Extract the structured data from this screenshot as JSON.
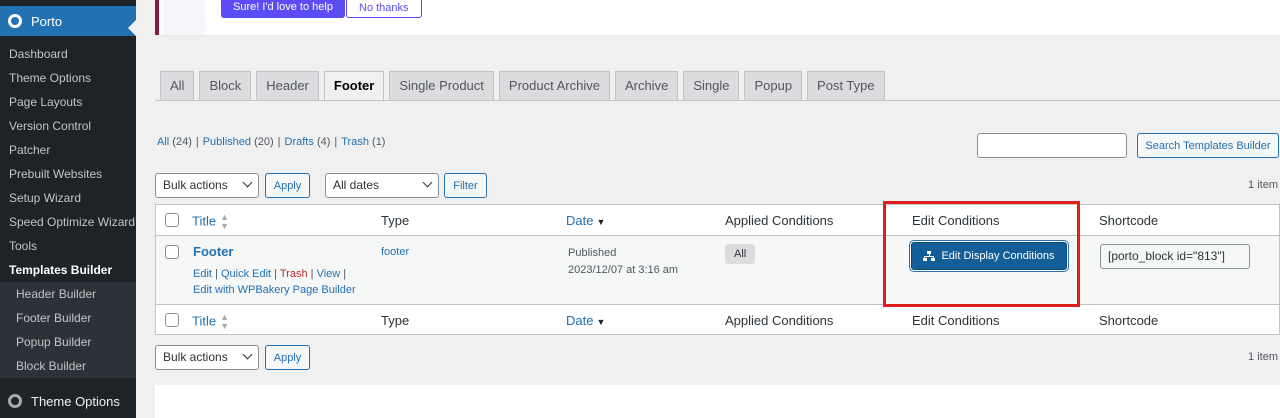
{
  "sidebar": {
    "brand": "Porto",
    "items": [
      {
        "label": "Dashboard"
      },
      {
        "label": "Theme Options"
      },
      {
        "label": "Page Layouts"
      },
      {
        "label": "Version Control"
      },
      {
        "label": "Patcher"
      },
      {
        "label": "Prebuilt Websites"
      },
      {
        "label": "Setup Wizard"
      },
      {
        "label": "Speed Optimize Wizard"
      },
      {
        "label": "Tools"
      },
      {
        "label": "Templates Builder"
      }
    ],
    "subitems": [
      {
        "label": "Header Builder"
      },
      {
        "label": "Footer Builder"
      },
      {
        "label": "Popup Builder"
      },
      {
        "label": "Block Builder"
      }
    ],
    "bottom_label": "Theme Options"
  },
  "notice": {
    "accept_label": "Sure! I'd love to help",
    "decline_label": "No thanks"
  },
  "tabs": [
    {
      "label": "All"
    },
    {
      "label": "Block"
    },
    {
      "label": "Header"
    },
    {
      "label": "Footer"
    },
    {
      "label": "Single Product"
    },
    {
      "label": "Product Archive"
    },
    {
      "label": "Archive"
    },
    {
      "label": "Single"
    },
    {
      "label": "Popup"
    },
    {
      "label": "Post Type"
    }
  ],
  "active_tab": "Footer",
  "views": {
    "all": "All",
    "all_count": "(24)",
    "published": "Published",
    "published_count": "(20)",
    "drafts": "Drafts",
    "drafts_count": "(4)",
    "trash": "Trash",
    "trash_count": "(1)"
  },
  "search": {
    "button_label": "Search Templates Builder",
    "value": ""
  },
  "filters": {
    "bulk_actions": "Bulk actions",
    "apply_label": "Apply",
    "dates": "All dates",
    "filter_label": "Filter",
    "items_count": "1 item"
  },
  "columns": {
    "title": "Title",
    "type": "Type",
    "date": "Date",
    "applied": "Applied Conditions",
    "edit": "Edit Conditions",
    "shortcode": "Shortcode"
  },
  "row": {
    "title": "Footer",
    "actions": {
      "edit": "Edit",
      "quick_edit": "Quick Edit",
      "trash": "Trash",
      "view": "View",
      "wpbakery": "Edit with WPBakery Page Builder"
    },
    "type": "footer",
    "status": "Published",
    "date": "2023/12/07 at 3:16 am",
    "applied": "All",
    "edit_button": "Edit Display Conditions",
    "shortcode": "[porto_block id=\"813\"]"
  },
  "colors": {
    "sidebar_bg": "#1d2327",
    "accent": "#2271b1",
    "edit_button_bg": "#135e96",
    "highlight": "#e01e1e",
    "notice_primary": "#5b4cf5"
  }
}
